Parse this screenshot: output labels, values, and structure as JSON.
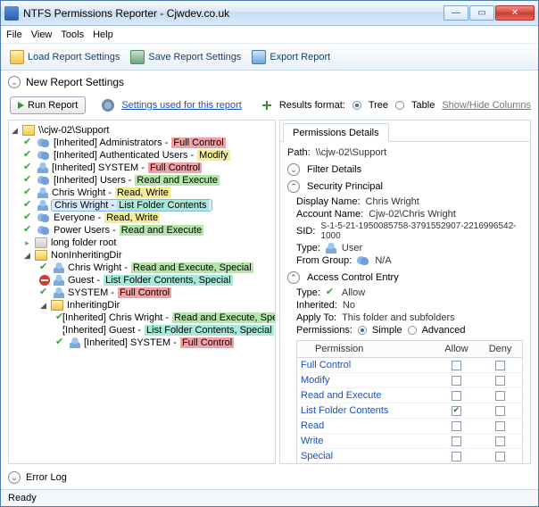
{
  "window": {
    "title": "NTFS Permissions Reporter - Cjwdev.co.uk"
  },
  "menu": {
    "file": "File",
    "view": "View",
    "tools": "Tools",
    "help": "Help"
  },
  "toolbar": {
    "load": "Load Report Settings",
    "save": "Save Report Settings",
    "export": "Export Report"
  },
  "sections": {
    "new_report": "New Report Settings",
    "error_log": "Error Log"
  },
  "runrow": {
    "run": "Run Report",
    "settings_link": "Settings used for this report",
    "results_fmt": "Results format:",
    "tree": "Tree",
    "table": "Table",
    "showhide": "Show/Hide Columns"
  },
  "tree": {
    "root": "\\\\cjw-02\\Support",
    "n0": {
      "p": "[Inherited] Administrators - ",
      "perm": "Full Control"
    },
    "n1": {
      "p": "[Inherited] Authenticated Users - ",
      "perm": "Modify"
    },
    "n2": {
      "p": "[Inherited] SYSTEM - ",
      "perm": "Full Control"
    },
    "n3": {
      "p": "[Inherited] Users - ",
      "perm": "Read and Execute"
    },
    "n4": {
      "p": "Chris Wright - ",
      "perm": "Read, Write"
    },
    "n5": {
      "p": "Chris Wright - ",
      "perm": "List Folder Contents"
    },
    "n6": {
      "p": "Everyone - ",
      "perm": "Read, Write"
    },
    "n7": {
      "p": "Power Users - ",
      "perm": "Read and Execute"
    },
    "long": "long folder root",
    "noninh": "NonInheritingDir",
    "nn0": {
      "p": "Chris Wright - ",
      "perm": "Read and Execute, Special"
    },
    "nn1": {
      "p": "Guest - ",
      "perm": "List Folder Contents, Special"
    },
    "nn2": {
      "p": "SYSTEM - ",
      "perm": "Full Control"
    },
    "inh": "InheritingDir",
    "in0": {
      "p": "[Inherited] Chris Wright - ",
      "perm": "Read and Execute, Special"
    },
    "in1": {
      "p": "[Inherited] Guest - ",
      "perm": "List Folder Contents, Special"
    },
    "in2": {
      "p": "[Inherited] SYSTEM - ",
      "perm": "Full Control"
    }
  },
  "details": {
    "tab": "Permissions Details",
    "path_lbl": "Path:",
    "path": "\\\\cjw-02\\Support",
    "filter": "Filter Details",
    "sp_hdr": "Security Principal",
    "dn_lbl": "Display Name:",
    "dn": "Chris Wright",
    "an_lbl": "Account Name:",
    "an": "Cjw-02\\Chris Wright",
    "sid_lbl": "SID:",
    "sid": "S-1-5-21-1950085758-3791552907-2216996542-1000",
    "type_lbl": "Type:",
    "type": "User",
    "fg_lbl": "From Group:",
    "fg": "N/A",
    "ace_hdr": "Access Control Entry",
    "ace_type_lbl": "Type:",
    "ace_type": "Allow",
    "inh_lbl": "Inherited:",
    "inh": "No",
    "apply_lbl": "Apply To:",
    "apply": "This folder and subfolders",
    "perm_lbl": "Permissions:",
    "simple": "Simple",
    "advanced": "Advanced",
    "th_perm": "Permission",
    "th_allow": "Allow",
    "th_deny": "Deny",
    "rows": [
      {
        "name": "Full Control",
        "allow": false,
        "deny": false
      },
      {
        "name": "Modify",
        "allow": false,
        "deny": false
      },
      {
        "name": "Read and Execute",
        "allow": false,
        "deny": false
      },
      {
        "name": "List Folder Contents",
        "allow": true,
        "deny": false
      },
      {
        "name": "Read",
        "allow": false,
        "deny": false
      },
      {
        "name": "Write",
        "allow": false,
        "deny": false
      },
      {
        "name": "Special",
        "allow": false,
        "deny": false
      }
    ]
  },
  "status": "Ready"
}
